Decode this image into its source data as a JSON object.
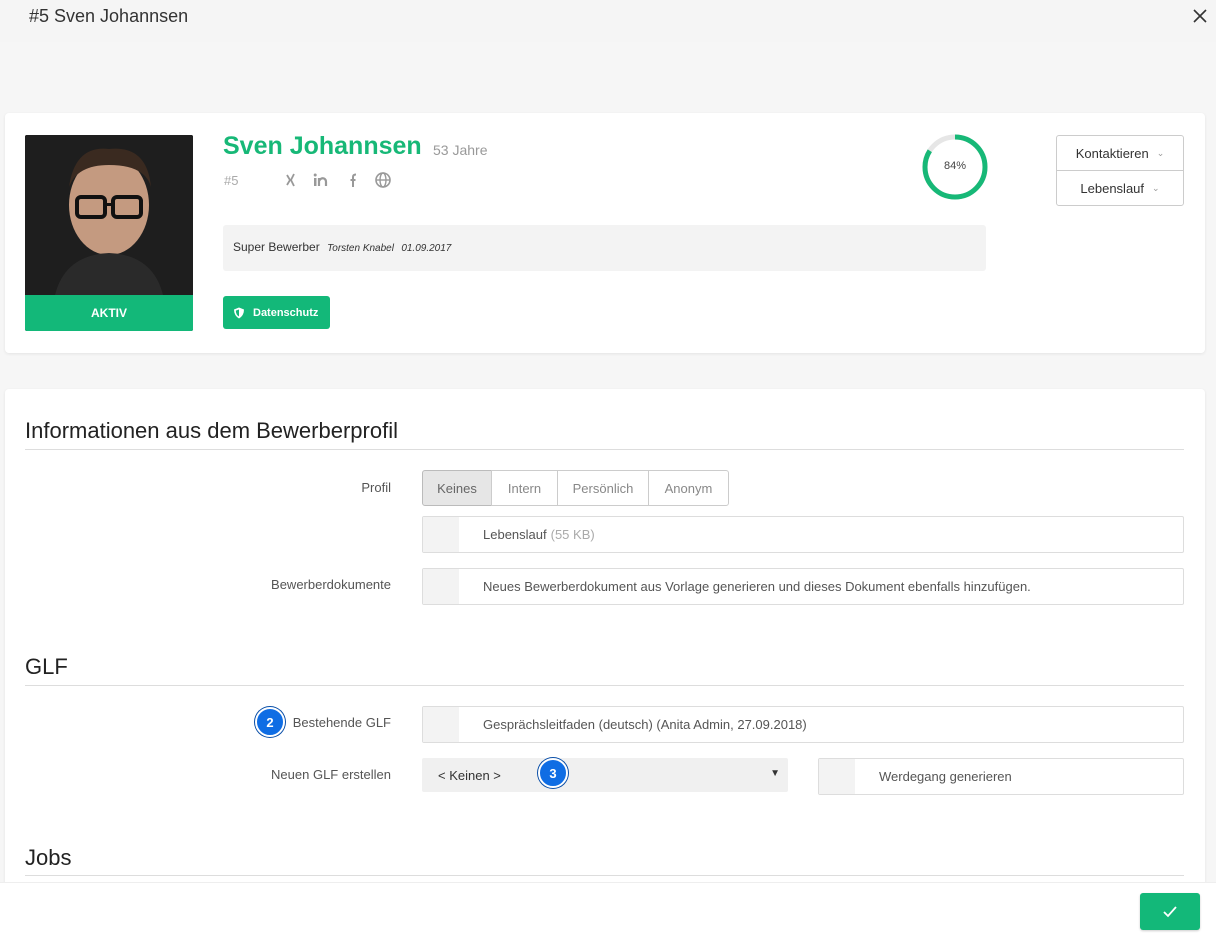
{
  "window": {
    "title": "#5 Sven Johannsen"
  },
  "candidate": {
    "name": "Sven Johannsen",
    "age": "53 Jahre",
    "id": "#5",
    "status": "AKTIV",
    "progress_label": "84%",
    "progress_value": 0.84,
    "note": {
      "text": "Super Bewerber",
      "author": "Torsten Knabel",
      "date": "01.09.2017"
    },
    "privacy_label": "Datenschutz",
    "social_icons": [
      "xing-icon",
      "linkedin-icon",
      "facebook-icon",
      "globe-icon"
    ]
  },
  "actions": {
    "contact_label": "Kontaktieren",
    "cv_label": "Lebenslauf"
  },
  "sections": {
    "profile_info": {
      "title": "Informationen aus dem Bewerberprofil",
      "profile_label": "Profil",
      "profile_options": [
        "Keines",
        "Intern",
        "Persönlich",
        "Anonym"
      ],
      "profile_selected": "Keines",
      "documents_label": "Bewerberdokumente",
      "document_file": {
        "name": "Lebenslauf",
        "size": "(55 KB)"
      },
      "document_generate": "Neues Bewerberdokument aus Vorlage generieren und dieses Dokument ebenfalls hinzufügen."
    },
    "glf": {
      "title": "GLF",
      "existing_label": "Bestehende GLF",
      "existing_value": "Gesprächsleitfaden (deutsch) (Anita Admin, 27.09.2018)",
      "new_label": "Neuen GLF erstellen",
      "new_select_value": "< Keinen >",
      "career_button": "Werdegang generieren"
    },
    "jobs": {
      "title": "Jobs"
    }
  },
  "badges": {
    "b2": "2",
    "b3": "3"
  },
  "colors": {
    "accent": "#13b879",
    "badge": "#0f6de4"
  }
}
